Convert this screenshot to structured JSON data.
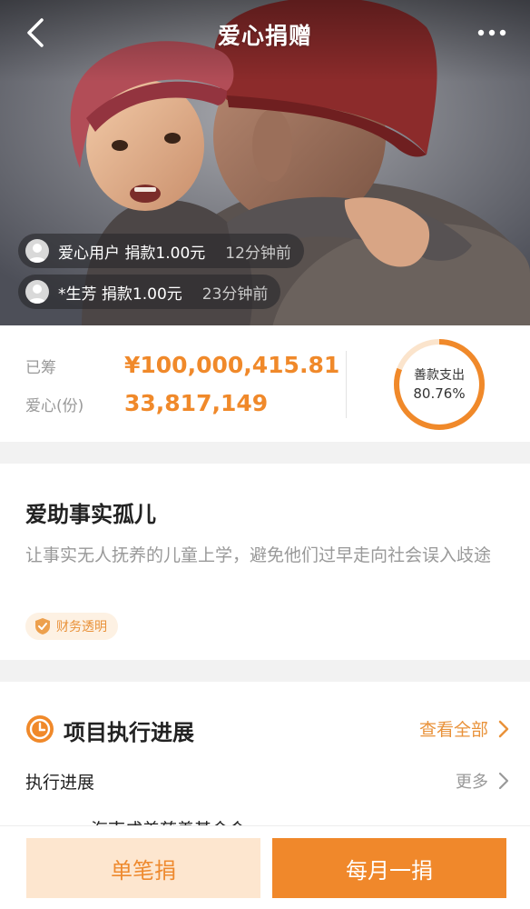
{
  "header": {
    "title": "爱心捐赠"
  },
  "donations": [
    {
      "user": "爱心用户",
      "action": "捐款1.00元",
      "time": "12分钟前"
    },
    {
      "user": "*生芳",
      "action": "捐款1.00元",
      "time": "23分钟前"
    }
  ],
  "stats": {
    "raised_label": "已筹",
    "raised_value": "¥100,000,415.81",
    "love_label": "爱心(份)",
    "love_value": "33,817,149",
    "spend_label": "善款支出",
    "spend_value": "80.76%",
    "spend_fraction": 0.8076,
    "accent_color": "#f0892a"
  },
  "project": {
    "title": "爱助事实孤儿",
    "description": "让事实无人抚养的儿童上学，避免他们过早走向社会误入歧途",
    "badge": "财务透明"
  },
  "progress": {
    "title": "项目执行进展",
    "view_all": "查看全部",
    "exec_label": "执行进展",
    "more": "更多",
    "org_peek": "海南成美慈善基金会"
  },
  "footer": {
    "single_label": "单笔捐",
    "monthly_label": "每月一捐"
  }
}
